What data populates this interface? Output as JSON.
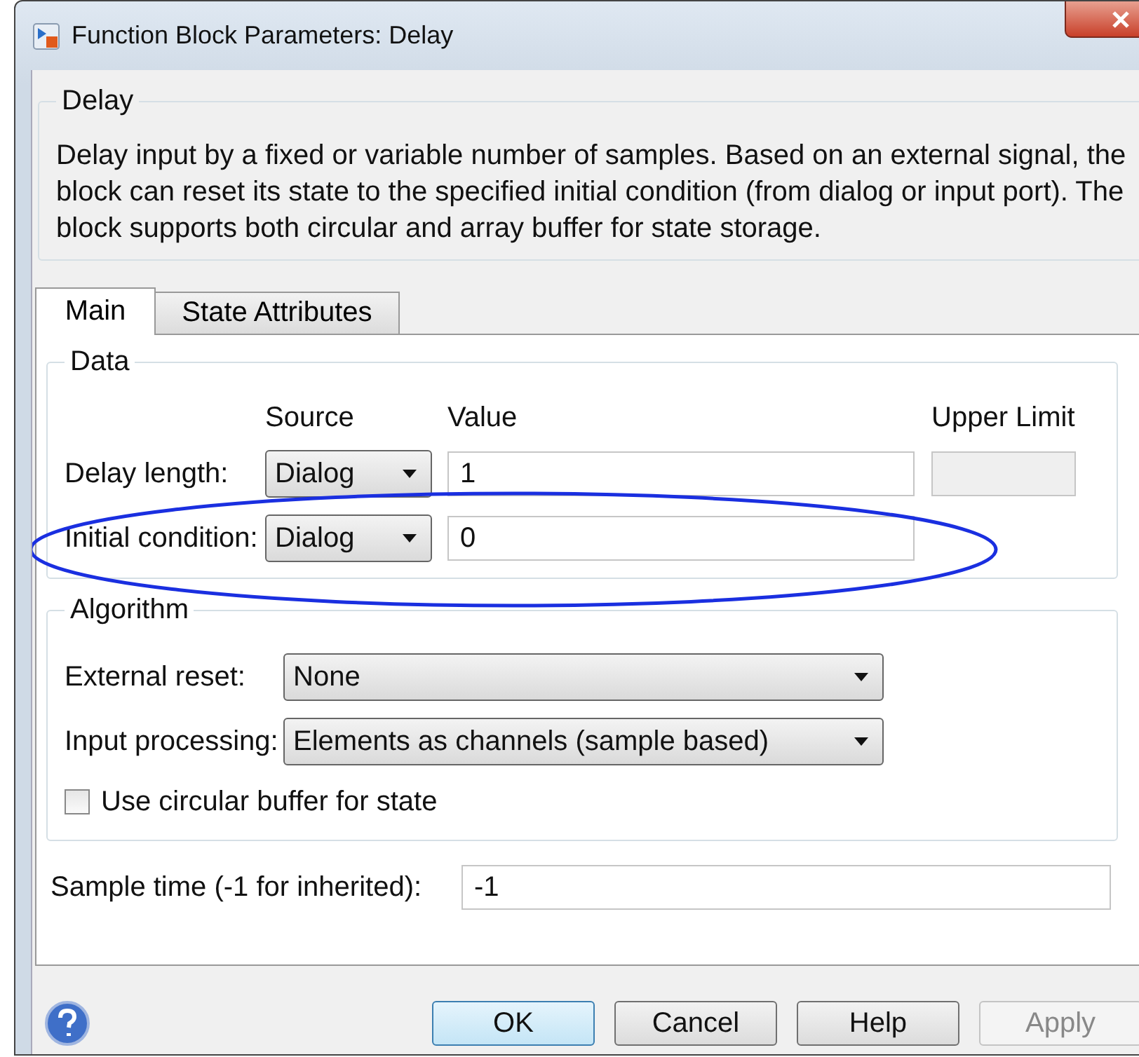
{
  "window": {
    "title": "Function Block Parameters: Delay"
  },
  "block": {
    "name": "Delay",
    "description": "Delay input by a fixed or variable number of samples. Based on an external signal, the block can reset its state to the specified initial condition (from dialog or input port). The block supports both circular and array buffer for state storage."
  },
  "tabs": [
    {
      "label": "Main",
      "selected": true
    },
    {
      "label": "State Attributes",
      "selected": false
    }
  ],
  "data_group": {
    "title": "Data",
    "columns": [
      "Source",
      "Value",
      "Upper Limit"
    ],
    "rows": [
      {
        "label": "Delay length:",
        "source": "Dialog",
        "value": "1",
        "has_upper_limit": true
      },
      {
        "label": "Initial condition:",
        "source": "Dialog",
        "value": "0",
        "has_upper_limit": false
      }
    ]
  },
  "algorithm_group": {
    "title": "Algorithm",
    "dropdowns": [
      {
        "label": "External reset:",
        "value": "None"
      },
      {
        "label": "Input processing:",
        "value": "Elements as channels (sample based)"
      }
    ],
    "checkbox": {
      "label": "Use circular buffer for state",
      "checked": false
    }
  },
  "sample_time": {
    "label": "Sample time (-1 for inherited):",
    "value": "-1"
  },
  "buttons": [
    {
      "label": "OK",
      "default": true,
      "disabled": false
    },
    {
      "label": "Cancel",
      "default": false,
      "disabled": false
    },
    {
      "label": "Help",
      "default": false,
      "disabled": false
    },
    {
      "label": "Apply",
      "default": false,
      "disabled": true
    }
  ]
}
